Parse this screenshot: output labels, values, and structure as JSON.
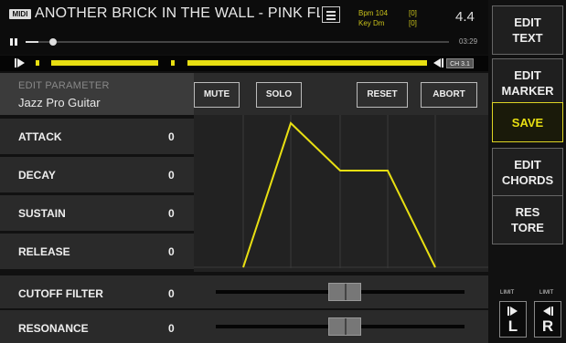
{
  "header": {
    "midi_badge": "MIDI",
    "song_title": "ANOTHER BRICK IN THE WALL - PINK FLOYI",
    "bpm_label": "Bpm 104",
    "key_label": "Key Dm",
    "bpm_box": "[0]",
    "key_box": "[0]",
    "time_signature": "4.4",
    "elapsed_time": "03:29",
    "playback_progress": 0.03
  },
  "timeline": {
    "channel_badge": "CH 3.1"
  },
  "edit_parameter": {
    "title": "EDIT PARAMETER",
    "instrument": "Jazz Pro Guitar"
  },
  "buttons": {
    "mute": "MUTE",
    "solo": "SOLO",
    "reset": "RESET",
    "abort": "ABORT"
  },
  "parameters": [
    {
      "name": "ATTACK",
      "value": "0"
    },
    {
      "name": "DECAY",
      "value": "0"
    },
    {
      "name": "SUSTAIN",
      "value": "0"
    },
    {
      "name": "RELEASE",
      "value": "0"
    }
  ],
  "sliders": [
    {
      "name": "CUTOFF FILTER",
      "value": "0",
      "level": 0.5
    },
    {
      "name": "RESONANCE",
      "value": "0",
      "level": 0.5
    }
  ],
  "sidebar": {
    "edit_text": [
      "EDIT",
      "TEXT"
    ],
    "edit_marker": [
      "EDIT",
      "MARKER"
    ],
    "save": [
      "SAVE"
    ],
    "edit_chords": [
      "EDIT",
      "CHORDS"
    ],
    "restore": [
      "RES",
      "TORE"
    ],
    "limit_label": "LIMIT",
    "limit_left": "L",
    "limit_right": "R"
  },
  "colors": {
    "accent": "#e8df12",
    "background": "#111111",
    "panel": "#2a2a2a"
  }
}
